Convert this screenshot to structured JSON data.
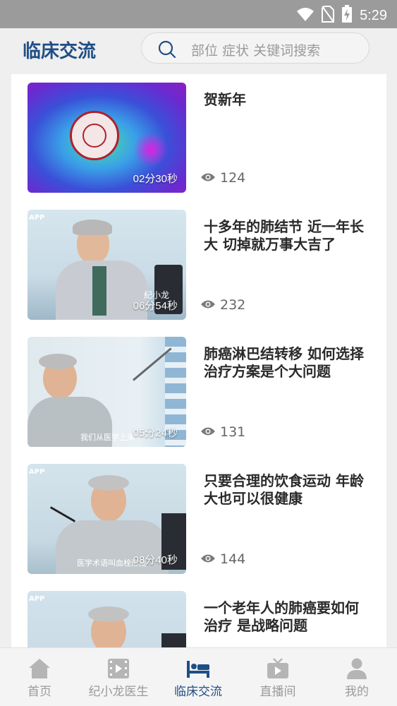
{
  "status_bar": {
    "time": "5:29"
  },
  "header": {
    "title": "临床交流"
  },
  "search": {
    "placeholder": "部位 症状 关键词搜索"
  },
  "videos": [
    {
      "title": "贺新年",
      "duration": "02分30秒",
      "views": "124"
    },
    {
      "title": "十多年的肺结节 近一年长大 切掉就万事大吉了",
      "duration": "06分54秒",
      "views": "232",
      "overlay_name": "纪小龙",
      "logo": "APP"
    },
    {
      "title": "肺癌淋巴结转移 如何选择治疗方案是个大问题",
      "duration": "05分24秒",
      "views": "131",
      "subtitle": "我们从医学上来"
    },
    {
      "title": "只要合理的饮食运动 年龄大也可以很健康",
      "duration": "08分40秒",
      "views": "144",
      "subtitle": "医学术语叫血栓形成",
      "logo": "APP"
    },
    {
      "title": "一个老年人的肺癌要如何治疗 是战略问题",
      "logo": "APP"
    }
  ],
  "tabs": [
    {
      "label": "首页",
      "icon": "home-icon",
      "active": false
    },
    {
      "label": "纪小龙医生",
      "icon": "video-icon",
      "active": false
    },
    {
      "label": "临床交流",
      "icon": "bed-icon",
      "active": true
    },
    {
      "label": "直播间",
      "icon": "tv-icon",
      "active": false
    },
    {
      "label": "我的",
      "icon": "person-icon",
      "active": false
    }
  ],
  "colors": {
    "accent": "#1f4e86",
    "inactive": "#b5b5b5"
  }
}
